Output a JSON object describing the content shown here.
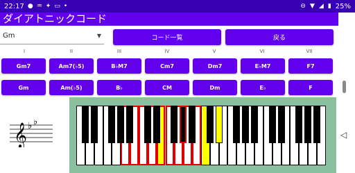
{
  "status_bar": {
    "time": "22:17",
    "battery": "25%"
  },
  "app_bar": {
    "title": "ダイアトニックコード"
  },
  "key_spinner": {
    "selected": "Gm"
  },
  "buttons": {
    "chord_list": "コード一覧",
    "back": "戻る"
  },
  "degrees": [
    "I",
    "II",
    "III",
    "IV",
    "V",
    "VI",
    "VII"
  ],
  "seventh_chords": [
    "Gm7",
    "Am7(♭5)",
    "B♭M7",
    "Cm7",
    "Dm7",
    "E♭M7",
    "F7"
  ],
  "triads": [
    "Gm",
    "Am(♭5)",
    "B♭",
    "CM",
    "Dm",
    "E♭",
    "F"
  ],
  "keyboard": {
    "red_highlight": "red",
    "yellow_highlight": "yellow",
    "red_white_keys": [
      5,
      6,
      7,
      8,
      9,
      10,
      11,
      12,
      13
    ],
    "yellow_white_keys": [
      9,
      14
    ],
    "red_black_keys": [
      "8"
    ],
    "yellow_black_keys": [
      "11"
    ]
  },
  "colors": {
    "primary": "#6200ee",
    "status": "#3700b3",
    "frame": "#88c0a0"
  }
}
